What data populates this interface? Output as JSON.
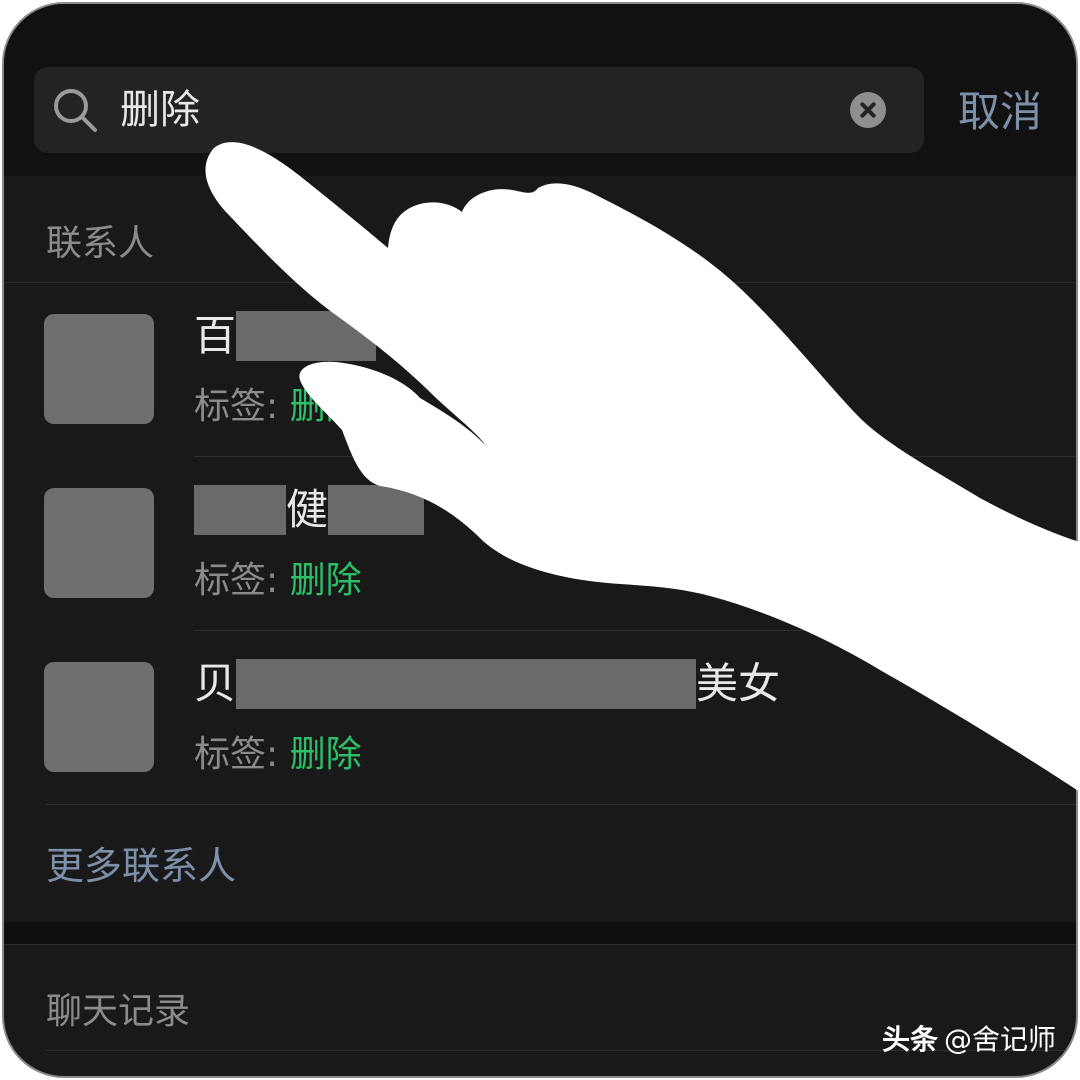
{
  "search": {
    "query": "删除",
    "cancel_label": "取消"
  },
  "contacts": {
    "header": "联系人",
    "items": [
      {
        "name_prefix": "百",
        "name_middle": "",
        "name_suffix": "",
        "tag_label": "标签:",
        "tag_value": "删除"
      },
      {
        "name_prefix": "",
        "name_middle": "健",
        "name_suffix": "",
        "tag_label": "标签:",
        "tag_value": "删除"
      },
      {
        "name_prefix": "贝",
        "name_middle": "",
        "name_suffix": "美女",
        "tag_label": "标签:",
        "tag_value": "删除"
      }
    ],
    "more_label": "更多联系人"
  },
  "chat_history": {
    "header": "聊天记录"
  },
  "watermark": {
    "brand": "头条",
    "handle": "@舍记师"
  },
  "colors": {
    "background": "#191919",
    "accent_link": "#7d90a9",
    "tag_green": "#2fbf68"
  },
  "icons": [
    "search-icon",
    "clear-icon",
    "hand-pointer-icon"
  ]
}
